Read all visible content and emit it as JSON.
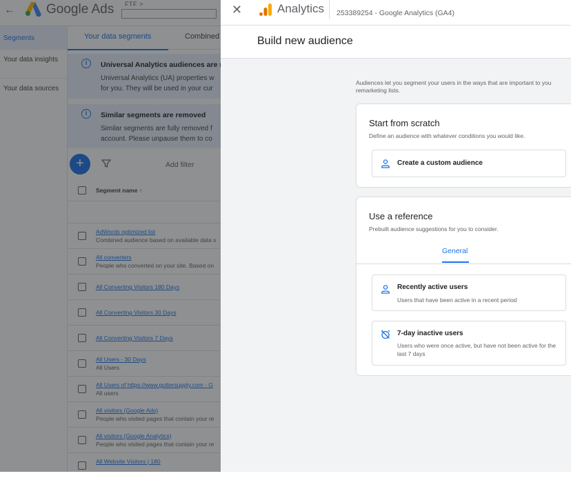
{
  "ads": {
    "back_icon": "arrow-back-icon",
    "brand": "Google Ads",
    "account_label": "FTF >",
    "sidebar": [
      {
        "label": "Segments"
      },
      {
        "label": "Your data insights"
      },
      {
        "label": "Your data sources"
      }
    ],
    "tabs": [
      {
        "label": "Your data segments"
      },
      {
        "label": "Combined"
      }
    ],
    "notices": [
      {
        "title": "Universal Analytics audiences are m",
        "line1": "Universal Analytics (UA) properties w",
        "line2": "for you. They will be used in your cur"
      },
      {
        "title": "Similar segments are removed",
        "line1": "Similar segments are fully removed f",
        "line2": "account. Please unpause them to co"
      }
    ],
    "add_filter": "Add filter",
    "column_header": "Segment name",
    "rows": [
      {
        "name": "AdWords optimized list",
        "desc": "Combined audience based on available data s"
      },
      {
        "name": "All converters",
        "desc": "People who converted on your site. Based on"
      },
      {
        "name": "All Converting Visitors 180 Days",
        "desc": ""
      },
      {
        "name": "All Converting Visitors 30 Days",
        "desc": ""
      },
      {
        "name": "All Converting Visitors 7 Days",
        "desc": ""
      },
      {
        "name": "All Users - 30 Days",
        "desc": "All Users"
      },
      {
        "name": "All Users of https://www.guttersupply.com - G",
        "desc": "All users"
      },
      {
        "name": "All visitors (Google Ads)",
        "desc": "People who visited pages that contain your re"
      },
      {
        "name": "All visitors (Google Analytics)",
        "desc": "People who visited pages that contain your re"
      },
      {
        "name": "All Website Visitors | 180",
        "desc": ""
      }
    ]
  },
  "panel": {
    "close_icon": "close-icon",
    "brand": "Analytics",
    "property": "253389254 - Google Analytics (GA4)",
    "title": "Build new audience",
    "intro_line1": "Audiences let you segment your users in the ways that are important to you",
    "intro_line2": "remarketing lists.",
    "scratch": {
      "title": "Start from scratch",
      "subtitle": "Define an audience with whatever conditions you would like.",
      "option": "Create a custom audience"
    },
    "reference": {
      "title": "Use a reference",
      "subtitle": "Prebuilt audience suggestions for you to consider.",
      "tab": "General",
      "options": [
        {
          "title": "Recently active users",
          "desc": "Users that have been active in a recent period",
          "icon": "person-icon"
        },
        {
          "title": "7-day inactive users",
          "desc": "Users who were once active, but have not been active for the last 7 days",
          "icon": "alarm-off-icon"
        }
      ]
    }
  },
  "colors": {
    "accent": "#1a73e8",
    "notice_bg": "#e8f0fe",
    "panel_bg": "#f1f3f4",
    "ga_orange": "#f9ab00",
    "ga_dark_orange": "#e37400"
  }
}
